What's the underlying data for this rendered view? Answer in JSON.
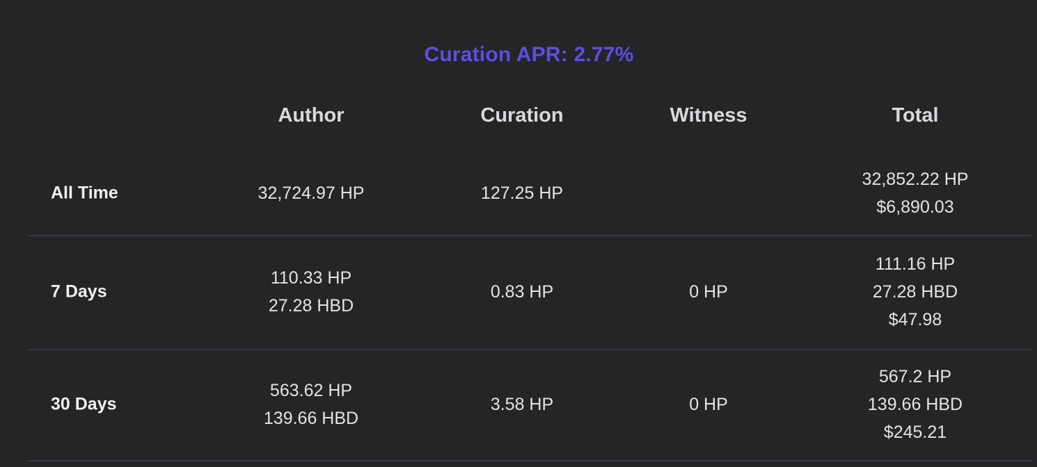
{
  "title": "Curation APR: 2.77%",
  "columns": {
    "author": "Author",
    "curation": "Curation",
    "witness": "Witness",
    "total": "Total"
  },
  "rows": [
    {
      "label": "All Time",
      "author": [
        "32,724.97 HP"
      ],
      "curation": [
        "127.25 HP"
      ],
      "witness": [],
      "total": [
        "32,852.22 HP",
        "$6,890.03"
      ]
    },
    {
      "label": "7 Days",
      "author": [
        "110.33 HP",
        "27.28 HBD"
      ],
      "curation": [
        "0.83 HP"
      ],
      "witness": [
        "0 HP"
      ],
      "total": [
        "111.16 HP",
        "27.28 HBD",
        "$47.98"
      ]
    },
    {
      "label": "30 Days",
      "author": [
        "563.62 HP",
        "139.66 HBD"
      ],
      "curation": [
        "3.58 HP"
      ],
      "witness": [
        "0 HP"
      ],
      "total": [
        "567.2 HP",
        "139.66 HBD",
        "$245.21"
      ]
    }
  ]
}
